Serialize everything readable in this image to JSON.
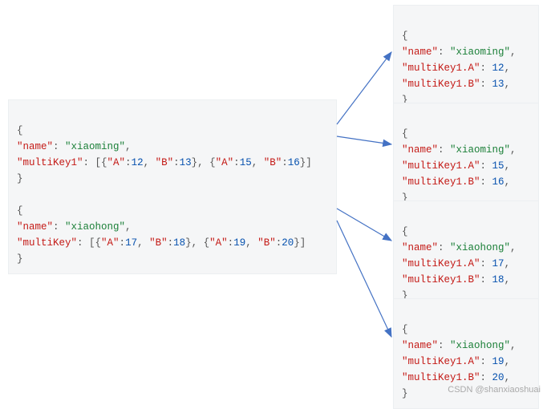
{
  "left": {
    "block1": {
      "open": "{",
      "l1_key": "\"name\"",
      "l1_colon": ": ",
      "l1_val": "\"xiaoming\"",
      "l1_end": ",",
      "l2_key": "\"multiKey1\"",
      "l2_colon": ": [{",
      "l2_a_key": "\"A\"",
      "l2_a_colon": ":",
      "l2_a_val": "12",
      "l2_sep1": ", ",
      "l2_b_key": "\"B\"",
      "l2_b_colon": ":",
      "l2_b_val": "13",
      "l2_mid": "}, {",
      "l2_c_key": "\"A\"",
      "l2_c_colon": ":",
      "l2_c_val": "15",
      "l2_sep2": ", ",
      "l2_d_key": "\"B\"",
      "l2_d_colon": ":",
      "l2_d_val": "16",
      "l2_end": "}]",
      "close": "}"
    },
    "block2": {
      "open": "{",
      "l1_key": "\"name\"",
      "l1_colon": ": ",
      "l1_val": "\"xiaohong\"",
      "l1_end": ",",
      "l2_key": "\"multiKey\"",
      "l2_colon": ": [{",
      "l2_a_key": "\"A\"",
      "l2_a_colon": ":",
      "l2_a_val": "17",
      "l2_sep1": ", ",
      "l2_b_key": "\"B\"",
      "l2_b_colon": ":",
      "l2_b_val": "18",
      "l2_mid": "}, {",
      "l2_c_key": "\"A\"",
      "l2_c_colon": ":",
      "l2_c_val": "19",
      "l2_sep2": ", ",
      "l2_d_key": "\"B\"",
      "l2_d_colon": ":",
      "l2_d_val": "20",
      "l2_end": "}]",
      "close": "}"
    }
  },
  "right": {
    "r1": {
      "open": "{",
      "name_key": "\"name\"",
      "name_colon": ": ",
      "name_val": "\"xiaoming\"",
      "name_end": ",",
      "a_key": "\"multiKey1.A\"",
      "a_colon": ": ",
      "a_val": "12",
      "a_end": ",",
      "b_key": "\"multiKey1.B\"",
      "b_colon": ": ",
      "b_val": "13",
      "b_end": ",",
      "close": "}"
    },
    "r2": {
      "open": "{",
      "name_key": "\"name\"",
      "name_colon": ": ",
      "name_val": "\"xiaoming\"",
      "name_end": ",",
      "a_key": "\"multiKey1.A\"",
      "a_colon": ": ",
      "a_val": "15",
      "a_end": ",",
      "b_key": "\"multiKey1.B\"",
      "b_colon": ": ",
      "b_val": "16",
      "b_end": ",",
      "close": "}"
    },
    "r3": {
      "open": "{",
      "name_key": "\"name\"",
      "name_colon": ": ",
      "name_val": "\"xiaohong\"",
      "name_end": ",",
      "a_key": "\"multiKey1.A\"",
      "a_colon": ": ",
      "a_val": "17",
      "a_end": ",",
      "b_key": "\"multiKey1.B\"",
      "b_colon": ": ",
      "b_val": "18",
      "b_end": ",",
      "close": "}"
    },
    "r4": {
      "open": "{",
      "name_key": "\"name\"",
      "name_colon": ": ",
      "name_val": "\"xiaohong\"",
      "name_end": ",",
      "a_key": "\"multiKey1.A\"",
      "a_colon": ": ",
      "a_val": "19",
      "a_end": ",",
      "b_key": "\"multiKey1.B\"",
      "b_colon": ": ",
      "b_val": "20",
      "b_end": ",",
      "close": "}"
    }
  },
  "watermark": "CSDN @shanxiaoshuai",
  "arrow_color": "#4472c4"
}
